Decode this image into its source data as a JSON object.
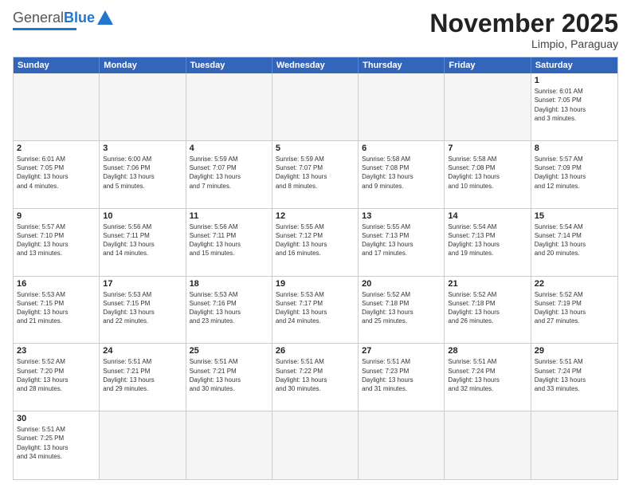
{
  "logo": {
    "general": "General",
    "blue": "Blue"
  },
  "title": "November 2025",
  "location": "Limpio, Paraguay",
  "header_days": [
    "Sunday",
    "Monday",
    "Tuesday",
    "Wednesday",
    "Thursday",
    "Friday",
    "Saturday"
  ],
  "weeks": [
    [
      {
        "day": "",
        "info": "",
        "empty": true
      },
      {
        "day": "",
        "info": "",
        "empty": true
      },
      {
        "day": "",
        "info": "",
        "empty": true
      },
      {
        "day": "",
        "info": "",
        "empty": true
      },
      {
        "day": "",
        "info": "",
        "empty": true
      },
      {
        "day": "",
        "info": "",
        "empty": true
      },
      {
        "day": "1",
        "info": "Sunrise: 6:01 AM\nSunset: 7:05 PM\nDaylight: 13 hours\nand 3 minutes.",
        "empty": false
      }
    ],
    [
      {
        "day": "2",
        "info": "Sunrise: 6:01 AM\nSunset: 7:05 PM\nDaylight: 13 hours\nand 4 minutes.",
        "empty": false
      },
      {
        "day": "3",
        "info": "Sunrise: 6:00 AM\nSunset: 7:06 PM\nDaylight: 13 hours\nand 5 minutes.",
        "empty": false
      },
      {
        "day": "4",
        "info": "Sunrise: 5:59 AM\nSunset: 7:07 PM\nDaylight: 13 hours\nand 7 minutes.",
        "empty": false
      },
      {
        "day": "5",
        "info": "Sunrise: 5:59 AM\nSunset: 7:07 PM\nDaylight: 13 hours\nand 8 minutes.",
        "empty": false
      },
      {
        "day": "6",
        "info": "Sunrise: 5:58 AM\nSunset: 7:08 PM\nDaylight: 13 hours\nand 9 minutes.",
        "empty": false
      },
      {
        "day": "7",
        "info": "Sunrise: 5:58 AM\nSunset: 7:08 PM\nDaylight: 13 hours\nand 10 minutes.",
        "empty": false
      },
      {
        "day": "8",
        "info": "Sunrise: 5:57 AM\nSunset: 7:09 PM\nDaylight: 13 hours\nand 12 minutes.",
        "empty": false
      }
    ],
    [
      {
        "day": "9",
        "info": "Sunrise: 5:57 AM\nSunset: 7:10 PM\nDaylight: 13 hours\nand 13 minutes.",
        "empty": false
      },
      {
        "day": "10",
        "info": "Sunrise: 5:56 AM\nSunset: 7:11 PM\nDaylight: 13 hours\nand 14 minutes.",
        "empty": false
      },
      {
        "day": "11",
        "info": "Sunrise: 5:56 AM\nSunset: 7:11 PM\nDaylight: 13 hours\nand 15 minutes.",
        "empty": false
      },
      {
        "day": "12",
        "info": "Sunrise: 5:55 AM\nSunset: 7:12 PM\nDaylight: 13 hours\nand 16 minutes.",
        "empty": false
      },
      {
        "day": "13",
        "info": "Sunrise: 5:55 AM\nSunset: 7:13 PM\nDaylight: 13 hours\nand 17 minutes.",
        "empty": false
      },
      {
        "day": "14",
        "info": "Sunrise: 5:54 AM\nSunset: 7:13 PM\nDaylight: 13 hours\nand 19 minutes.",
        "empty": false
      },
      {
        "day": "15",
        "info": "Sunrise: 5:54 AM\nSunset: 7:14 PM\nDaylight: 13 hours\nand 20 minutes.",
        "empty": false
      }
    ],
    [
      {
        "day": "16",
        "info": "Sunrise: 5:53 AM\nSunset: 7:15 PM\nDaylight: 13 hours\nand 21 minutes.",
        "empty": false
      },
      {
        "day": "17",
        "info": "Sunrise: 5:53 AM\nSunset: 7:15 PM\nDaylight: 13 hours\nand 22 minutes.",
        "empty": false
      },
      {
        "day": "18",
        "info": "Sunrise: 5:53 AM\nSunset: 7:16 PM\nDaylight: 13 hours\nand 23 minutes.",
        "empty": false
      },
      {
        "day": "19",
        "info": "Sunrise: 5:53 AM\nSunset: 7:17 PM\nDaylight: 13 hours\nand 24 minutes.",
        "empty": false
      },
      {
        "day": "20",
        "info": "Sunrise: 5:52 AM\nSunset: 7:18 PM\nDaylight: 13 hours\nand 25 minutes.",
        "empty": false
      },
      {
        "day": "21",
        "info": "Sunrise: 5:52 AM\nSunset: 7:18 PM\nDaylight: 13 hours\nand 26 minutes.",
        "empty": false
      },
      {
        "day": "22",
        "info": "Sunrise: 5:52 AM\nSunset: 7:19 PM\nDaylight: 13 hours\nand 27 minutes.",
        "empty": false
      }
    ],
    [
      {
        "day": "23",
        "info": "Sunrise: 5:52 AM\nSunset: 7:20 PM\nDaylight: 13 hours\nand 28 minutes.",
        "empty": false
      },
      {
        "day": "24",
        "info": "Sunrise: 5:51 AM\nSunset: 7:21 PM\nDaylight: 13 hours\nand 29 minutes.",
        "empty": false
      },
      {
        "day": "25",
        "info": "Sunrise: 5:51 AM\nSunset: 7:21 PM\nDaylight: 13 hours\nand 30 minutes.",
        "empty": false
      },
      {
        "day": "26",
        "info": "Sunrise: 5:51 AM\nSunset: 7:22 PM\nDaylight: 13 hours\nand 30 minutes.",
        "empty": false
      },
      {
        "day": "27",
        "info": "Sunrise: 5:51 AM\nSunset: 7:23 PM\nDaylight: 13 hours\nand 31 minutes.",
        "empty": false
      },
      {
        "day": "28",
        "info": "Sunrise: 5:51 AM\nSunset: 7:24 PM\nDaylight: 13 hours\nand 32 minutes.",
        "empty": false
      },
      {
        "day": "29",
        "info": "Sunrise: 5:51 AM\nSunset: 7:24 PM\nDaylight: 13 hours\nand 33 minutes.",
        "empty": false
      }
    ],
    [
      {
        "day": "30",
        "info": "Sunrise: 5:51 AM\nSunset: 7:25 PM\nDaylight: 13 hours\nand 34 minutes.",
        "empty": false
      },
      {
        "day": "",
        "info": "",
        "empty": true
      },
      {
        "day": "",
        "info": "",
        "empty": true
      },
      {
        "day": "",
        "info": "",
        "empty": true
      },
      {
        "day": "",
        "info": "",
        "empty": true
      },
      {
        "day": "",
        "info": "",
        "empty": true
      },
      {
        "day": "",
        "info": "",
        "empty": true
      }
    ]
  ]
}
